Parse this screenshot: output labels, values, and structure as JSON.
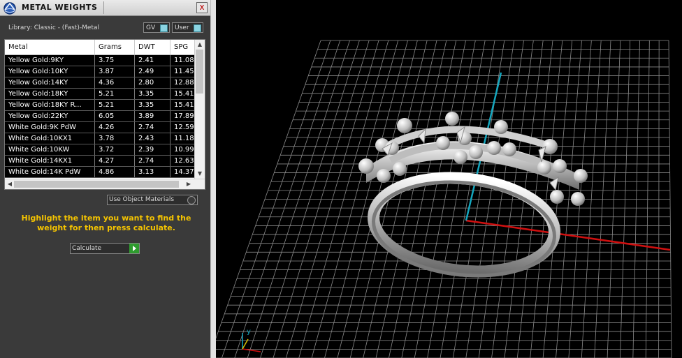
{
  "panel": {
    "title": "METAL WEIGHTS",
    "close_label": "x",
    "library": "Library: Classic - (Fast)-Metal",
    "toggle_gv": "GV",
    "toggle_user": "User",
    "use_object_materials": "Use Object Materials",
    "hint": "Highlight the item you want to find the weight for then press calculate.",
    "calculate": "Calculate"
  },
  "table": {
    "columns": [
      "Metal",
      "Grams",
      "DWT",
      "SPG"
    ],
    "rows": [
      [
        "Yellow Gold:9KY",
        "3.75",
        "2.41",
        "11.08"
      ],
      [
        "Yellow Gold:10KY",
        "3.87",
        "2.49",
        "11.45"
      ],
      [
        "Yellow Gold:14KY",
        "4.36",
        "2.80",
        "12.88"
      ],
      [
        "Yellow Gold:18KY",
        "5.21",
        "3.35",
        "15.41"
      ],
      [
        "Yellow Gold:18KY R...",
        "5.21",
        "3.35",
        "15.41"
      ],
      [
        "Yellow Gold:22KY",
        "6.05",
        "3.89",
        "17.89"
      ],
      [
        "White Gold:9K PdW",
        "4.26",
        "2.74",
        "12.59"
      ],
      [
        "White Gold:10KX1",
        "3.78",
        "2.43",
        "11.18"
      ],
      [
        "White Gold:10KW",
        "3.72",
        "2.39",
        "10.99"
      ],
      [
        "White Gold:14KX1",
        "4.27",
        "2.74",
        "12.63"
      ],
      [
        "White Gold:14K PdW",
        "4.86",
        "3.13",
        "14.37"
      ]
    ]
  },
  "viewport": {
    "axis_y_label": "y",
    "colors": {
      "grid": "#8a8a8a",
      "x_axis": "#d01010",
      "y_axis": "#14a7bf",
      "hint": "#f5c400"
    }
  }
}
